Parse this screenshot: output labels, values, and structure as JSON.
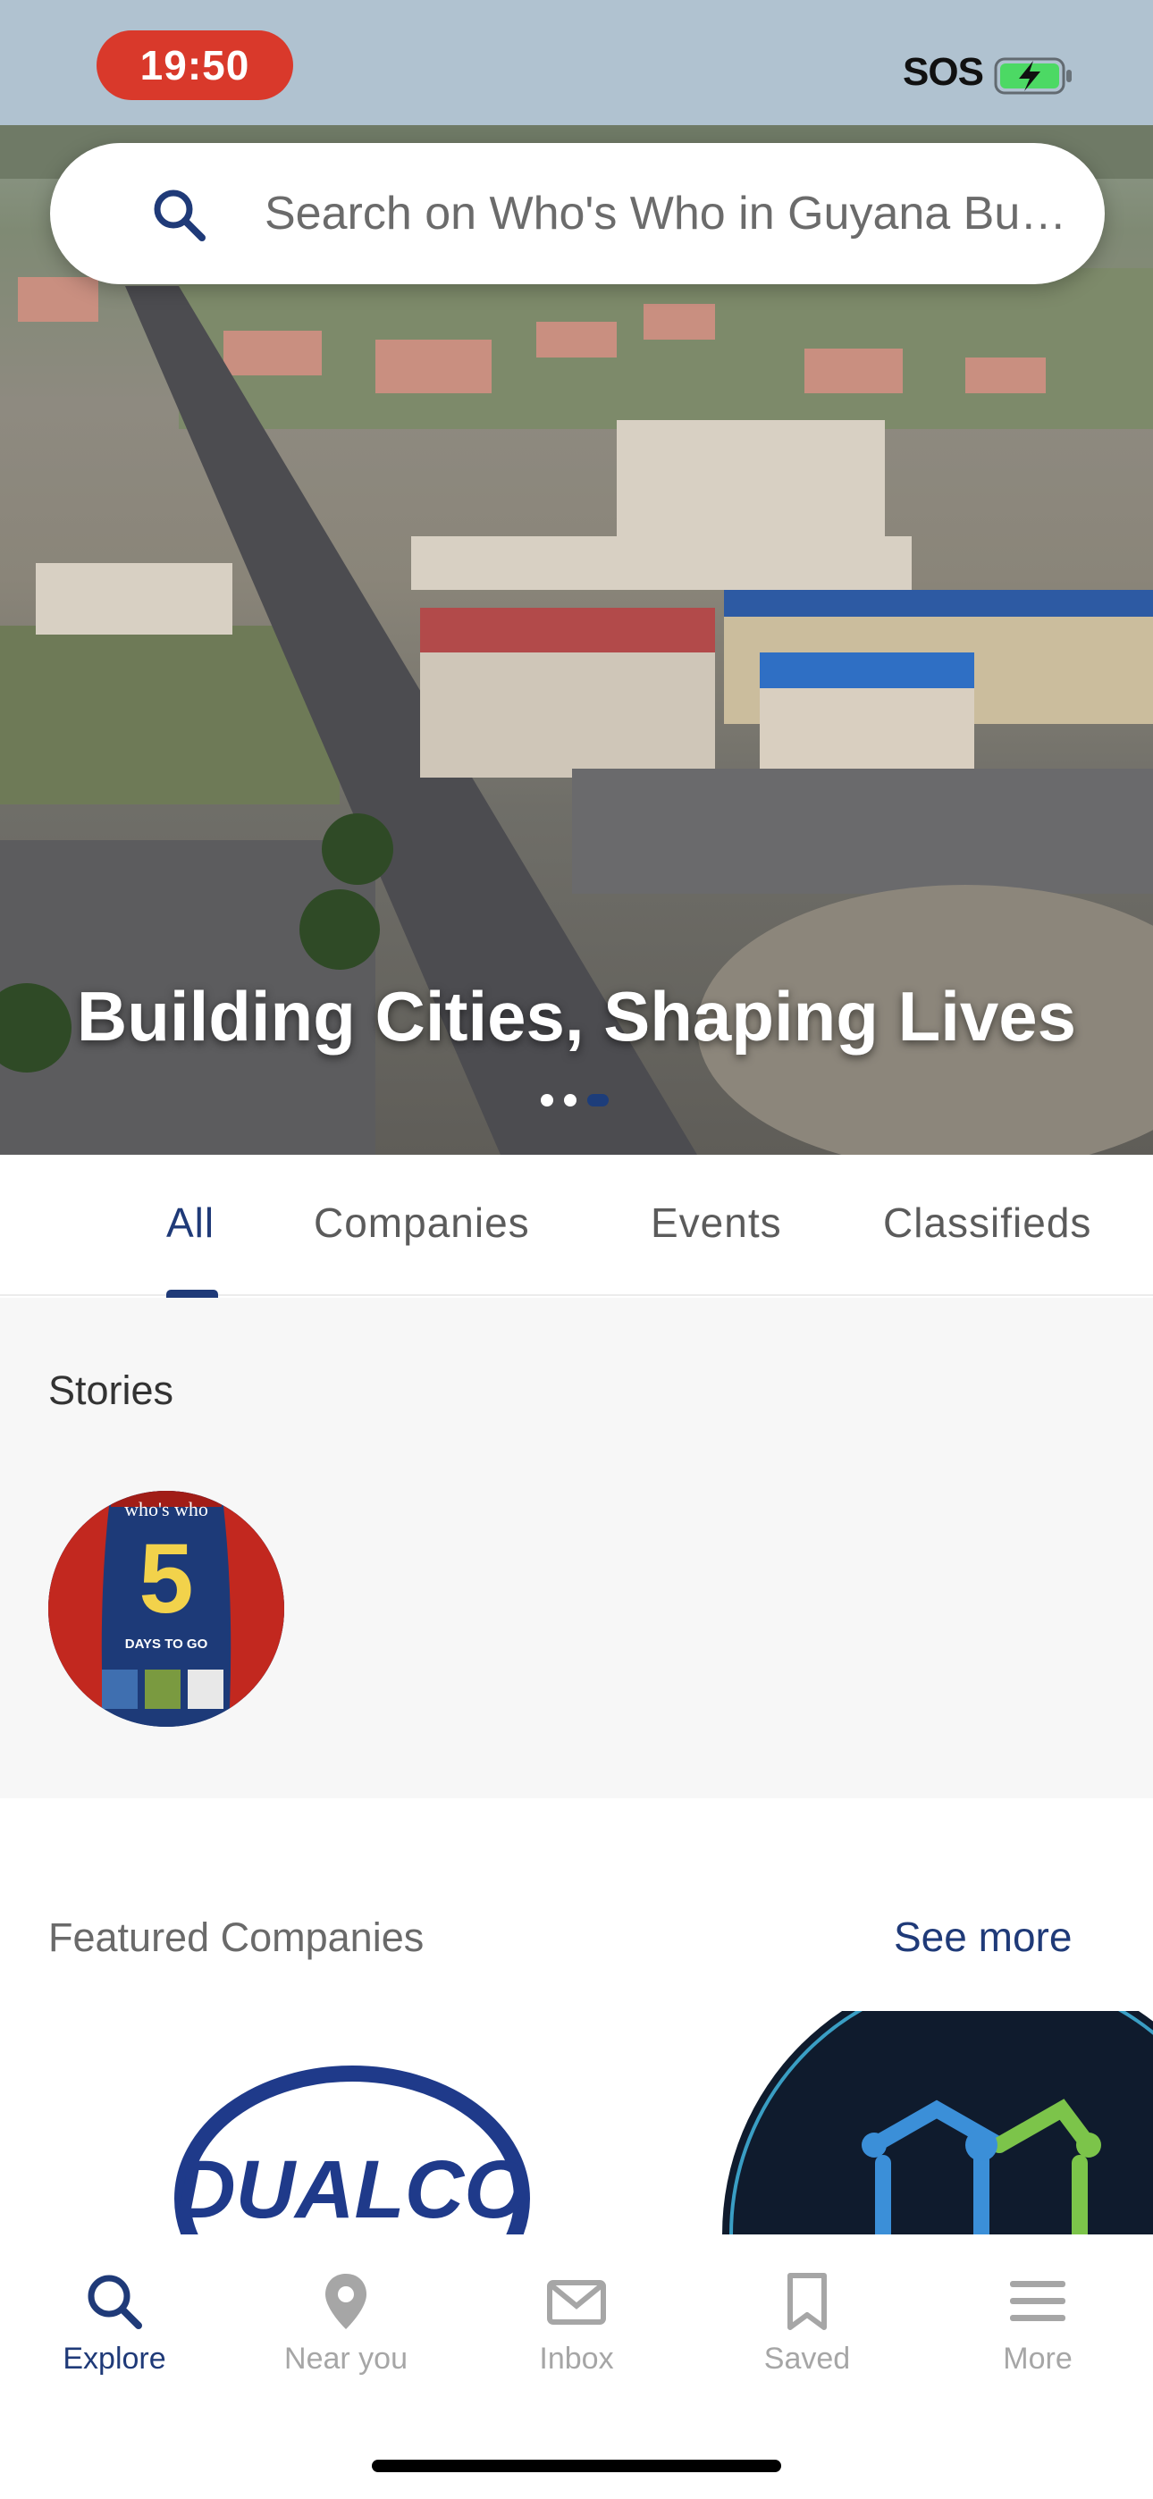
{
  "status_bar": {
    "time": "19:50",
    "signal_text": "SOS",
    "battery_icon": "battery-charging-icon"
  },
  "search": {
    "placeholder": "Search on Who's Who in Guyana Busi...",
    "icon": "search-icon"
  },
  "hero": {
    "title": "Building Cities, Shaping Lives",
    "carousel_total": 3,
    "carousel_active_index": 2
  },
  "tabs": [
    {
      "label": "All",
      "active": true
    },
    {
      "label": "Companies",
      "active": false
    },
    {
      "label": "Events",
      "active": false
    },
    {
      "label": "Classifieds",
      "active": false
    }
  ],
  "stories": {
    "title": "Stories",
    "items": [
      {
        "brand": "who's who",
        "big_number": "5",
        "headline": "DAYS TO GO"
      }
    ]
  },
  "featured": {
    "title": "Featured Companies",
    "see_more": "See more",
    "companies": [
      {
        "logo_text": "DUALCO"
      }
    ]
  },
  "bottom_nav": [
    {
      "label": "Explore",
      "icon": "search-icon",
      "active": true
    },
    {
      "label": "Near you",
      "icon": "location-pin-icon",
      "active": false
    },
    {
      "label": "Inbox",
      "icon": "mail-icon",
      "active": false
    },
    {
      "label": "Saved",
      "icon": "bookmark-icon",
      "active": false
    },
    {
      "label": "More",
      "icon": "menu-icon",
      "active": false
    }
  ],
  "colors": {
    "brand": "#1f3a78",
    "status_pill": "#d9392b",
    "inactive": "#a6a6a6"
  }
}
